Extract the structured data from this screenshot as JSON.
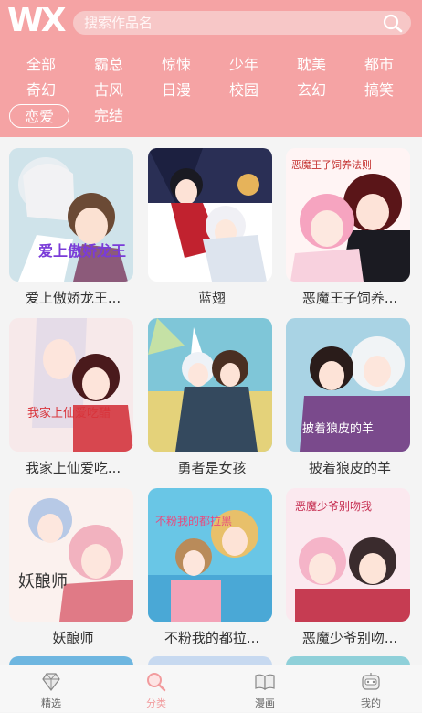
{
  "header": {
    "logo_text": "WX",
    "search": {
      "placeholder": "搜索作品名",
      "value": ""
    },
    "accent_color": "#f5a3a4"
  },
  "categories": {
    "items": [
      "全部",
      "霸总",
      "惊悚",
      "少年",
      "耽美",
      "都市",
      "奇幻",
      "古风",
      "日漫",
      "校园",
      "玄幻",
      "搞笑",
      "恋爱",
      "完结"
    ],
    "selected": "恋爱"
  },
  "comics": [
    {
      "title": "爱上傲娇龙王...",
      "cover_text": "爱上傲娇龙王"
    },
    {
      "title": "蓝翅",
      "cover_text": ""
    },
    {
      "title": "恶魔王子饲养...",
      "cover_text": "恶魔王子饲养法则"
    },
    {
      "title": "我家上仙爱吃...",
      "cover_text": "我家上仙爱吃醋"
    },
    {
      "title": "勇者是女孩",
      "cover_text": ""
    },
    {
      "title": "披着狼皮的羊",
      "cover_text": "披着狼皮的羊"
    },
    {
      "title": "妖酿师",
      "cover_text": "妖酿师"
    },
    {
      "title": "不粉我的都拉...",
      "cover_text": "不粉我的都拉黑"
    },
    {
      "title": "恶魔少爷别吻...",
      "cover_text": "恶魔少爷别吻我"
    }
  ],
  "tabbar": {
    "tabs": [
      {
        "label": "精选",
        "icon": "diamond-icon"
      },
      {
        "label": "分类",
        "icon": "search-icon"
      },
      {
        "label": "漫画",
        "icon": "book-icon"
      },
      {
        "label": "我的",
        "icon": "robot-icon"
      }
    ],
    "active": "分类",
    "active_color": "#f29c9e"
  }
}
